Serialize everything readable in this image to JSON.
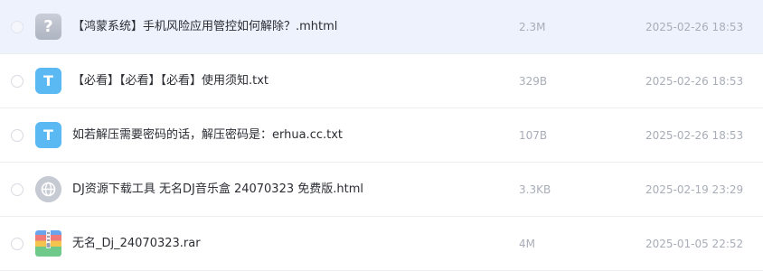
{
  "files": [
    {
      "name": "【鸿蒙系统】手机风险应用管控如何解除？.mhtml",
      "size": "2.3M",
      "date": "2025-02-26 18:53",
      "icon": "unknown-file-icon",
      "icon_glyph": "?"
    },
    {
      "name": "【必看】【必看】【必看】使用须知.txt",
      "size": "329B",
      "date": "2025-02-26 18:53",
      "icon": "text-file-icon",
      "icon_glyph": "T"
    },
    {
      "name": "如若解压需要密码的话，解压密码是：erhua.cc.txt",
      "size": "107B",
      "date": "2025-02-26 18:53",
      "icon": "text-file-icon",
      "icon_glyph": "T"
    },
    {
      "name": "DJ资源下载工具 无名DJ音乐盒 24070323 免费版.html",
      "size": "3.3KB",
      "date": "2025-02-19 23:29",
      "icon": "web-file-icon"
    },
    {
      "name": "无名_Dj_24070323.rar",
      "size": "4M",
      "date": "2025-01-05 22:52",
      "icon": "archive-file-icon"
    }
  ],
  "colors": {
    "selected_row_bg": "#eef2fd",
    "text_icon_blue": "#5ab8f3",
    "meta_text": "#a8adb7"
  }
}
